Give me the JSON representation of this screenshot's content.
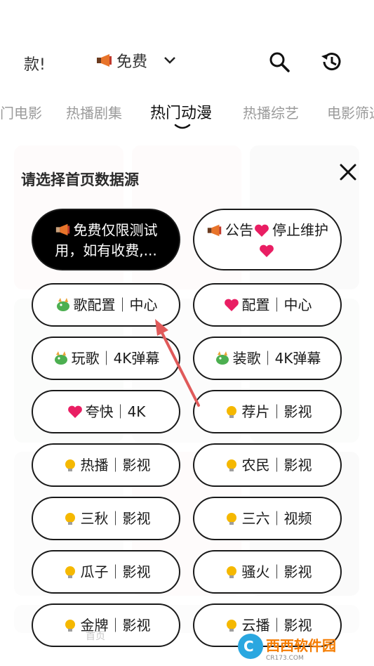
{
  "header": {
    "marquee_text": "款!",
    "source_label": "免费",
    "search_icon": "search-icon",
    "history_icon": "history-icon"
  },
  "tabs": [
    {
      "label": "门电影"
    },
    {
      "label": "热播剧集"
    },
    {
      "label": "热门动漫",
      "active": true
    },
    {
      "label": "热播综艺"
    },
    {
      "label": "电影筛选"
    }
  ],
  "sheet": {
    "title": "请选择首页数据源",
    "options": [
      {
        "label": "免费仅限测试用，如有收费,...",
        "icon": "megaphone-icon",
        "selected": true
      },
      {
        "label": "公告",
        "label2": "停止维护",
        "icon": "megaphone-icon",
        "heart": true
      },
      {
        "label": "歌配置｜中心",
        "icon": "dragon-icon"
      },
      {
        "label": "配置｜中心",
        "icon": "heart-icon"
      },
      {
        "label": "玩歌｜4K弹幕",
        "icon": "dragon-icon"
      },
      {
        "label": "装歌｜4K弹幕",
        "icon": "dragon-icon"
      },
      {
        "label": "夸快｜4K",
        "icon": "heart-icon"
      },
      {
        "label": "荐片｜影视",
        "icon": "bulb-icon"
      },
      {
        "label": "热播｜影视",
        "icon": "bulb-icon"
      },
      {
        "label": "农民｜影视",
        "icon": "bulb-icon"
      },
      {
        "label": "三秋｜影视",
        "icon": "bulb-icon"
      },
      {
        "label": "三六｜视频",
        "icon": "bulb-icon"
      },
      {
        "label": "瓜子｜影视",
        "icon": "bulb-icon"
      },
      {
        "label": "骚火｜影视",
        "icon": "bulb-icon"
      },
      {
        "label": "金牌｜影视",
        "icon": "bulb-icon"
      },
      {
        "label": "云播｜影视",
        "icon": "bulb-icon"
      }
    ]
  },
  "bottom_nav": {
    "home_label": "首页"
  },
  "watermark": {
    "text": "西西软件园",
    "sub": "CR173.COM"
  },
  "colors": {
    "accent": "#e91e63",
    "selected_bg": "#000000",
    "arrow": "#e05a5a"
  }
}
